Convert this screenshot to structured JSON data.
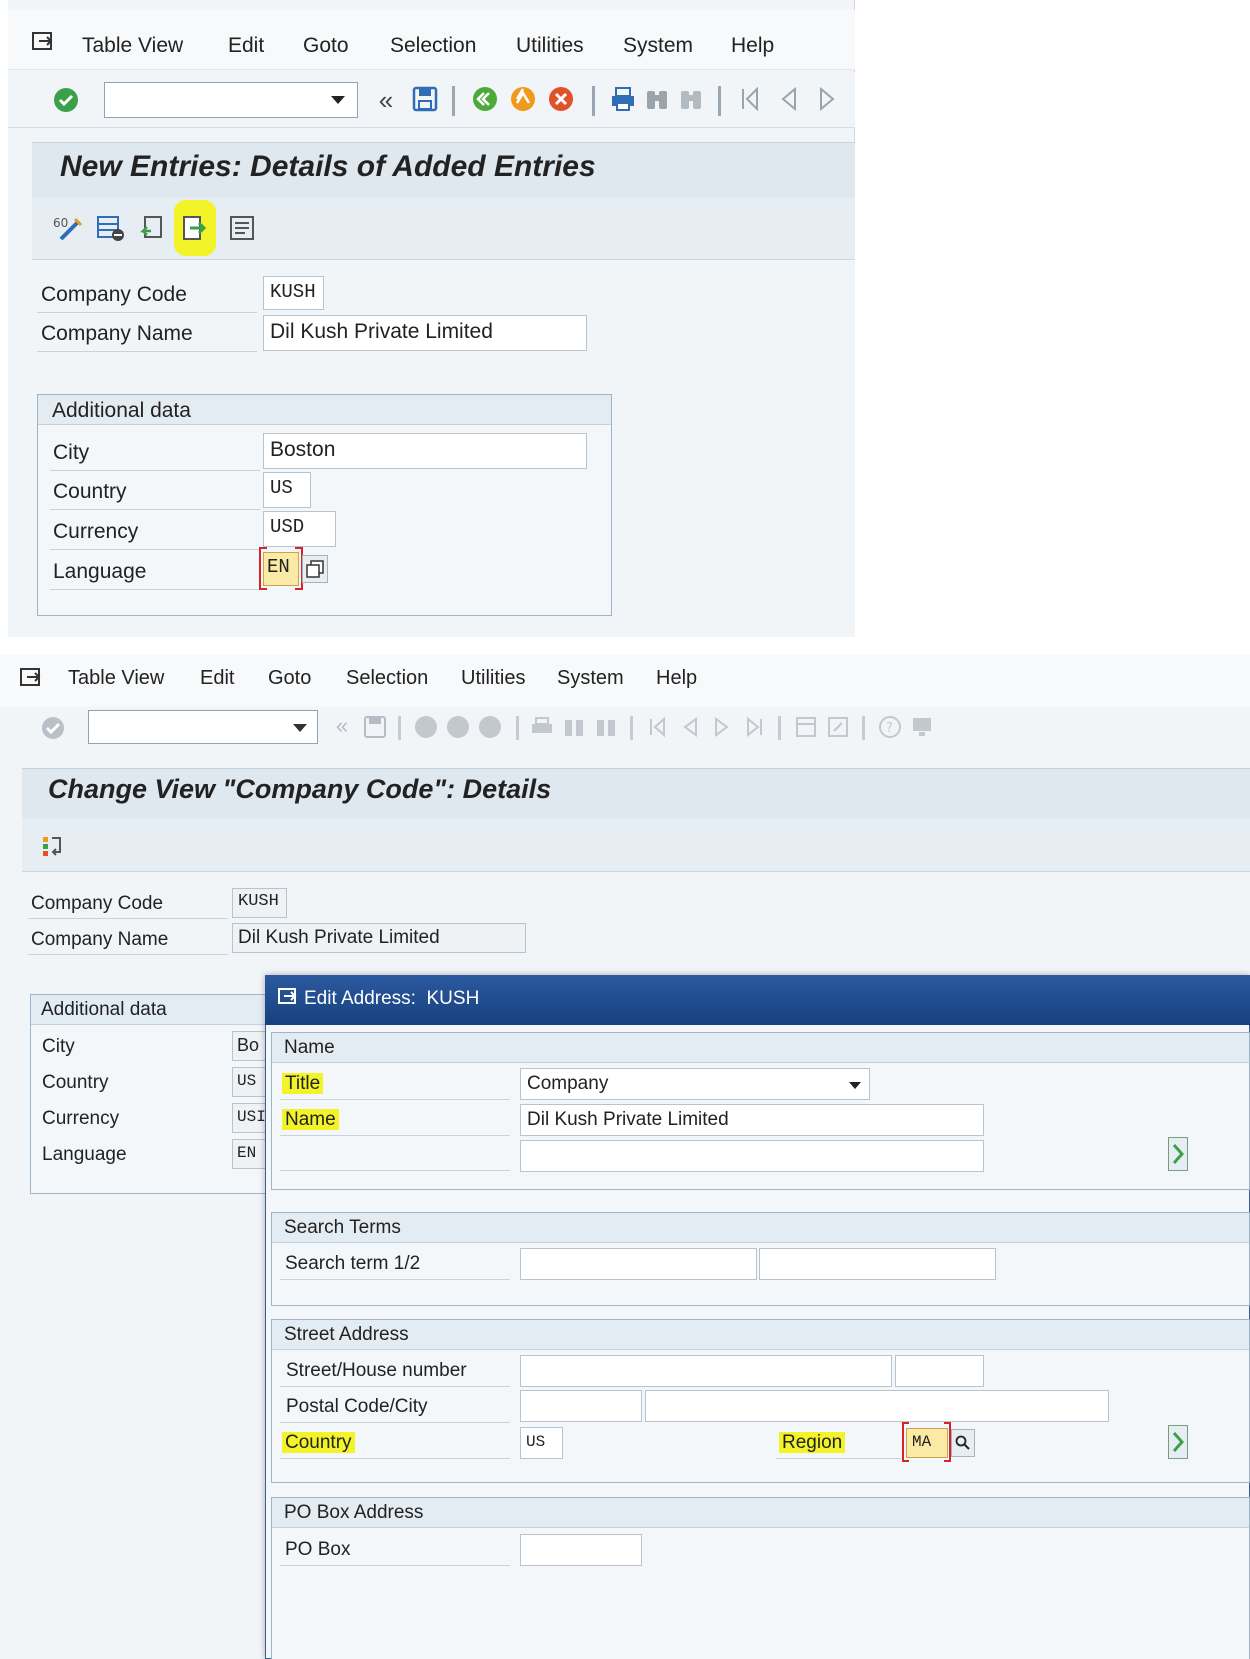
{
  "top": {
    "menu": [
      "Table View",
      "Edit",
      "Goto",
      "Selection",
      "Utilities",
      "System",
      "Help"
    ],
    "title": "New Entries: Details of Added Entries",
    "fields": {
      "company_code_label": "Company Code",
      "company_code": "KUSH",
      "company_name_label": "Company Name",
      "company_name": "Dil Kush Private Limited"
    },
    "additional": {
      "title": "Additional data",
      "city_label": "City",
      "city": "Boston",
      "country_label": "Country",
      "country": "US",
      "currency_label": "Currency",
      "currency": "USD",
      "language_label": "Language",
      "language": "EN"
    }
  },
  "bottom": {
    "menu": [
      "Table View",
      "Edit",
      "Goto",
      "Selection",
      "Utilities",
      "System",
      "Help"
    ],
    "title": "Change View \"Company Code\": Details",
    "fields": {
      "company_code_label": "Company Code",
      "company_code": "KUSH",
      "company_name_label": "Company Name",
      "company_name": "Dil Kush Private Limited"
    },
    "additional": {
      "title": "Additional data",
      "city_label": "City",
      "city": "Bo",
      "country_label": "Country",
      "country": "US",
      "currency_label": "Currency",
      "currency": "USI",
      "language_label": "Language",
      "language": "EN"
    },
    "dialog": {
      "title": "Edit Address:  KUSH",
      "name_section": "Name",
      "title_label": "Title",
      "title_value": "Company",
      "name_label": "Name",
      "name_value": "Dil Kush Private Limited",
      "search_section": "Search Terms",
      "search_label": "Search term 1/2",
      "street_section": "Street Address",
      "street_label": "Street/House number",
      "postal_label": "Postal Code/City",
      "country_label": "Country",
      "country_value": "US",
      "region_label": "Region",
      "region_value": "MA",
      "po_section": "PO Box Address",
      "po_label": "PO Box"
    }
  },
  "colors": {
    "highlight": "#f3f32a",
    "title_band": "#dfe7ef",
    "dialog_header": "#1c4a8c",
    "required_bracket": "#d6242a"
  }
}
